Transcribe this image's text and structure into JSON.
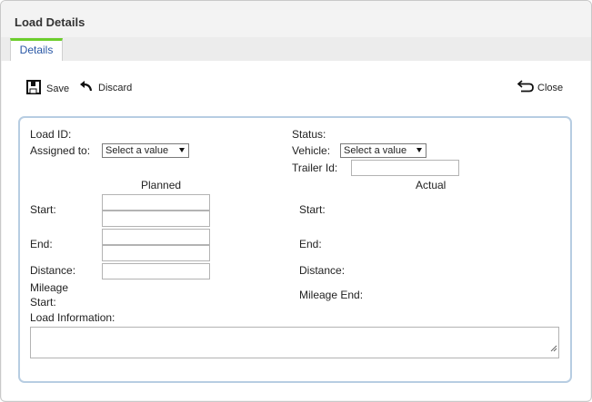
{
  "window": {
    "title": "Load Details"
  },
  "tabs": [
    {
      "label": "Details"
    }
  ],
  "toolbar": {
    "save_label": "Save",
    "discard_label": "Discard",
    "close_label": "Close"
  },
  "form": {
    "load_id_label": "Load ID:",
    "assigned_to_label": "Assigned to:",
    "assigned_to_value": "Select a value",
    "status_label": "Status:",
    "vehicle_label": "Vehicle:",
    "vehicle_value": "Select a value",
    "trailer_id_label": "Trailer Id:",
    "planned_heading": "Planned",
    "actual_heading": "Actual",
    "start_label": "Start:",
    "end_label": "End:",
    "distance_label": "Distance:",
    "mileage_start_label_line1": "Mileage",
    "mileage_start_label_line2": "Start:",
    "actual_start_label": "Start:",
    "actual_end_label": "End:",
    "actual_distance_label": "Distance:",
    "mileage_end_label": "Mileage End:",
    "load_information_label": "Load Information:"
  },
  "colors": {
    "tab_accent": "#6ccd2c",
    "panel_border": "#b7cde2",
    "tab_text": "#2a58a6"
  },
  "icons": {
    "save": "save-icon",
    "discard": "undo-arrow-icon",
    "close": "return-arrow-icon"
  }
}
